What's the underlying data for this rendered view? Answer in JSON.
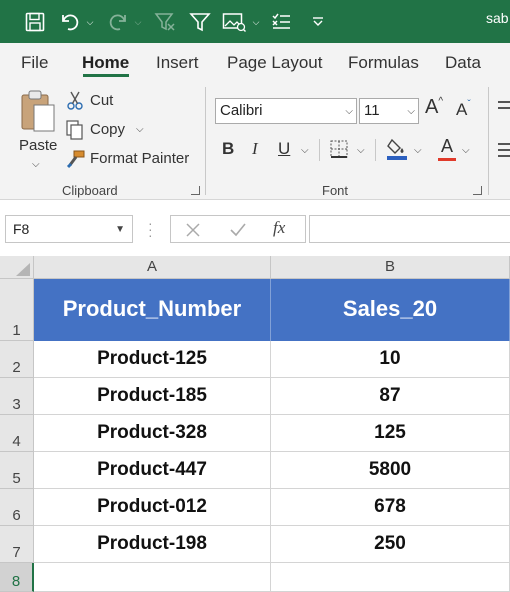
{
  "app": {
    "title_fragment": "sab",
    "brand_color": "#217346",
    "table_header_color": "#4472c4"
  },
  "quick_access": {
    "icons": [
      "save-icon",
      "undo-icon",
      "redo-icon",
      "clear-filter-icon",
      "filter-icon",
      "picture-icon",
      "checklist-icon",
      "customize-icon"
    ]
  },
  "tabs": [
    "File",
    "Home",
    "Insert",
    "Page Layout",
    "Formulas",
    "Data"
  ],
  "active_tab": "Home",
  "ribbon": {
    "clipboard": {
      "paste_label": "Paste",
      "cut_label": "Cut",
      "copy_label": "Copy",
      "format_painter_label": "Format Painter",
      "group_label": "Clipboard"
    },
    "font": {
      "font_name": "Calibri",
      "font_size": "11",
      "bold_label": "B",
      "italic_label": "I",
      "underline_label": "U",
      "increase_size_label": "A",
      "decrease_size_label": "A",
      "font_color_label": "A",
      "group_label": "Font"
    }
  },
  "formula_bar": {
    "name_box": "F8",
    "fx_label": "fx",
    "formula": ""
  },
  "sheet": {
    "columns": [
      "A",
      "B"
    ],
    "rows": [
      "1",
      "2",
      "3",
      "4",
      "5",
      "6",
      "7",
      "8"
    ],
    "selected_row": "8",
    "header": [
      "Product_Number",
      "Sales_20"
    ],
    "data": [
      [
        "Product-125",
        "10"
      ],
      [
        "Product-185",
        "87"
      ],
      [
        "Product-328",
        "125"
      ],
      [
        "Product-447",
        "5800"
      ],
      [
        "Product-012",
        "678"
      ],
      [
        "Product-198",
        "250"
      ]
    ]
  }
}
